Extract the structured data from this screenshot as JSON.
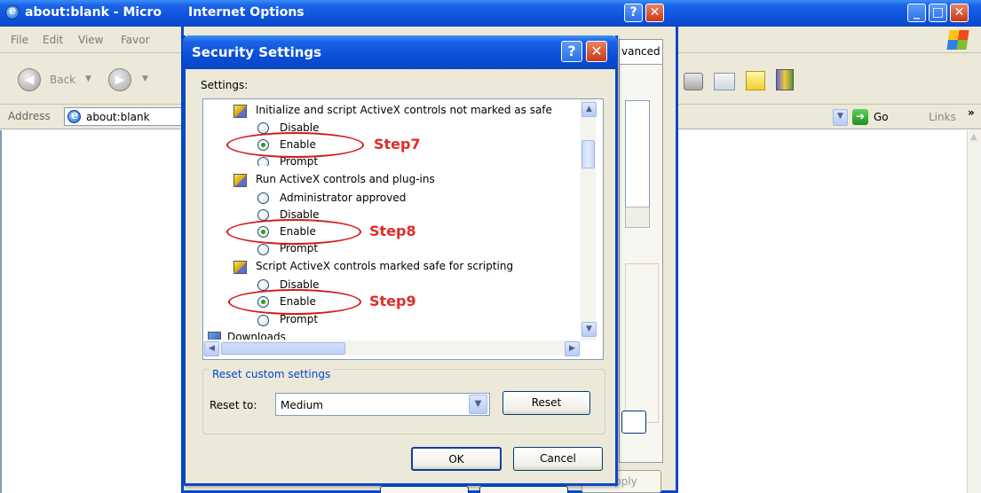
{
  "ie": {
    "title": "about:blank - Micro",
    "menu": [
      "File",
      "Edit",
      "View",
      "Favor"
    ],
    "back_label": "Back",
    "address_label": "Address",
    "address_value": "about:blank",
    "go_label": "Go",
    "links_label": "Links"
  },
  "internet_options": {
    "title": "Internet Options",
    "advanced_tab": "vanced",
    "apply_label": "pply"
  },
  "dialog": {
    "title": "Security Settings",
    "settings_label": "Settings:",
    "items": [
      {
        "type": "header",
        "label": "Initialize and script ActiveX controls not marked as safe"
      },
      {
        "type": "option",
        "label": "Disable",
        "selected": false
      },
      {
        "type": "option",
        "label": "Enable",
        "selected": true
      },
      {
        "type": "option",
        "label": "Prompt",
        "selected": false
      },
      {
        "type": "header",
        "label": "Run ActiveX controls and plug-ins"
      },
      {
        "type": "option",
        "label": "Administrator approved",
        "selected": false
      },
      {
        "type": "option",
        "label": "Disable",
        "selected": false
      },
      {
        "type": "option",
        "label": "Enable",
        "selected": true
      },
      {
        "type": "option",
        "label": "Prompt",
        "selected": false
      },
      {
        "type": "header",
        "label": "Script ActiveX controls marked safe for scripting"
      },
      {
        "type": "option",
        "label": "Disable",
        "selected": false
      },
      {
        "type": "option",
        "label": "Enable",
        "selected": true
      },
      {
        "type": "option",
        "label": "Prompt",
        "selected": false
      },
      {
        "type": "header",
        "label": "Downloads"
      }
    ],
    "steps": [
      "Step7",
      "Step8",
      "Step9"
    ],
    "reset_group": "Reset custom settings",
    "reset_to_label": "Reset to:",
    "reset_to_value": "Medium",
    "reset_button": "Reset",
    "ok_button": "OK",
    "cancel_button": "Cancel"
  },
  "colors": {
    "title_bar": "#0a48c8",
    "annotation": "#d41b1b",
    "radio_selected": "#21a121",
    "group_legend": "#0046d5"
  }
}
